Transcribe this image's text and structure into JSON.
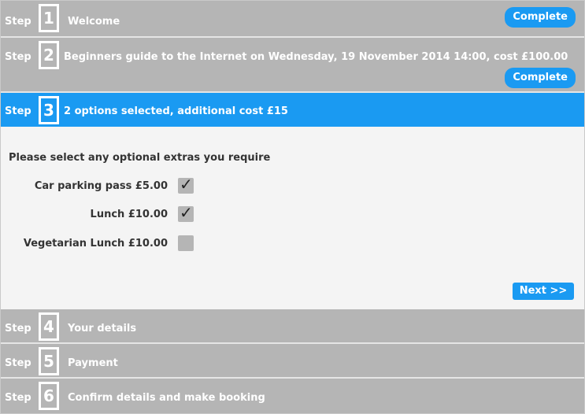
{
  "steps": [
    {
      "word": "Step",
      "number": "1",
      "title": "Welcome",
      "button_label": "Complete",
      "state": "complete"
    },
    {
      "word": "Step",
      "number": "2",
      "title": "Beginners guide to the Internet on Wednesday, 19 November 2014 14:00, cost £100.00",
      "button_label": "Complete",
      "state": "complete"
    },
    {
      "word": "Step",
      "number": "3",
      "title": "2 options selected, additional cost £15",
      "state": "active"
    },
    {
      "word": "Step",
      "number": "4",
      "title": "Your details",
      "state": "pending"
    },
    {
      "word": "Step",
      "number": "5",
      "title": "Payment",
      "state": "pending"
    },
    {
      "word": "Step",
      "number": "6",
      "title": "Confirm details and make booking",
      "state": "pending"
    }
  ],
  "panel": {
    "instruction": "Please select any optional extras you require",
    "options": [
      {
        "label": "Car parking pass £5.00",
        "checked": true,
        "check_glyph": "✓"
      },
      {
        "label": "Lunch £10.00",
        "checked": true,
        "check_glyph": "✓"
      },
      {
        "label": "Vegetarian Lunch £10.00",
        "checked": false,
        "check_glyph": ""
      }
    ],
    "next_label": "Next >>"
  },
  "colors": {
    "accent": "#1a9af2",
    "inactive_bar": "#b5b5b5",
    "panel_bg": "#f4f4f4"
  }
}
